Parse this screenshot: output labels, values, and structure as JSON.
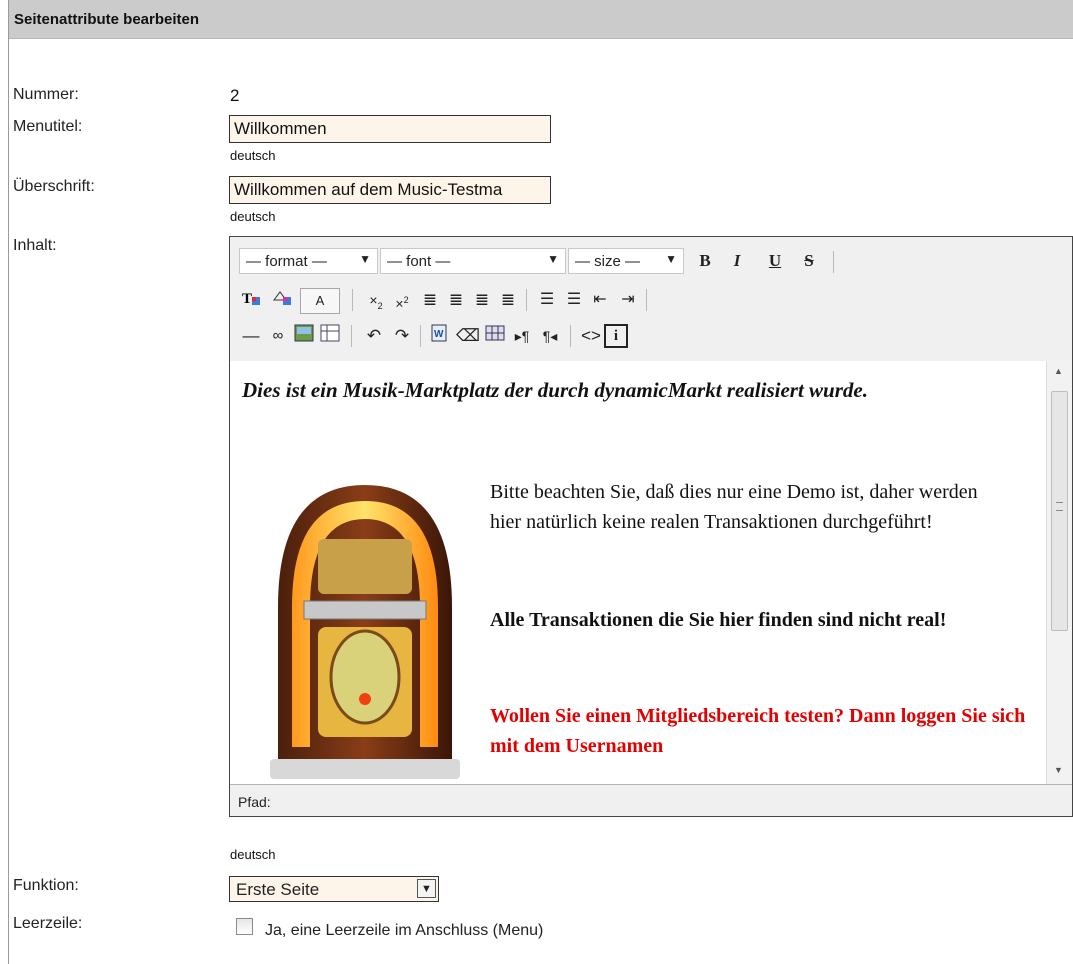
{
  "header": {
    "title": "Seitenattribute bearbeiten"
  },
  "form": {
    "nummer_label": "Nummer:",
    "nummer_value": "2",
    "menutitel_label": "Menutitel:",
    "menutitel_value": "Willkommen",
    "ueberschrift_label": "Überschrift:",
    "ueberschrift_value": "Willkommen auf dem Music-Testma",
    "inhalt_label": "Inhalt:",
    "funktion_label": "Funktion:",
    "funktion_value": "Erste Seite",
    "leerzeile_label": "Leerzeile:",
    "leerzeile_checkbox_label": "Ja, eine Leerzeile im Anschluss (Menu)",
    "language_menutitel": "deutsch",
    "language_ueberschrift": "deutsch",
    "language_inhalt": "deutsch"
  },
  "editor": {
    "format_select": "— format —",
    "font_select": "— font —",
    "size_select": "— size —",
    "bold": "B",
    "italic": "I",
    "underline": "U",
    "strike": "S",
    "path_label": "Pfad:",
    "content": {
      "heading": "Dies ist ein Musik-Marktplatz der durch dynamicMarkt realisiert wurde.",
      "para1": "Bitte beachten Sie, daß dies nur eine Demo ist, daher werden hier natürlich keine realen Transaktionen durchgeführt!",
      "para2": "Alle Transaktionen die Sie hier finden sind nicht real!",
      "para3": "Wollen Sie einen Mitgliedsbereich testen? Dann loggen Sie sich mit dem Usernamen",
      "image": "jukebox"
    }
  },
  "colors": {
    "accent_red": "#e30000",
    "header_bg": "#cbcbcb",
    "input_bg": "#fdf5ea"
  }
}
